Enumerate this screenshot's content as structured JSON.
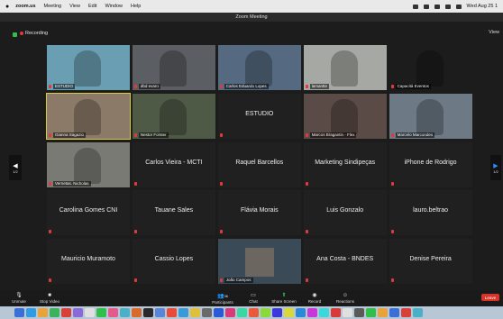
{
  "menubar": {
    "apple": "",
    "app": "zoom.us",
    "items": [
      "Meeting",
      "View",
      "Edit",
      "Window",
      "Help"
    ],
    "clock": "Wed Aug 25 1"
  },
  "window": {
    "title": "Zoom Meeting"
  },
  "status": {
    "recording": "Recording",
    "view": "View"
  },
  "nav": {
    "page_left": "1/2",
    "page_right": "1/2"
  },
  "tiles": [
    {
      "name": "ESTUDIO",
      "kind": "video",
      "color": "#6a9fb3"
    },
    {
      "name": "dbd evaro",
      "kind": "video",
      "color": "#5b5e63"
    },
    {
      "name": "Carlos Eduardo Lopes",
      "kind": "video",
      "color": "#556a80"
    },
    {
      "name": "lamantte",
      "kind": "video",
      "color": "#a6a8a3"
    },
    {
      "name": "Capacità Eventos",
      "kind": "video",
      "color": "#1c1c1c"
    },
    {
      "name": "Gianna Sagazio",
      "kind": "video",
      "color": "#8c7a68"
    },
    {
      "name": "Nestor Forster",
      "kind": "video",
      "color": "#4f5a46"
    },
    {
      "name": "",
      "label": "ESTUDIO",
      "kind": "text"
    },
    {
      "name": "Marcos Bragantin - Flex",
      "kind": "video",
      "color": "#5b4b46"
    },
    {
      "name": "Marcelo Marcondes",
      "kind": "video",
      "color": "#6d7a86"
    },
    {
      "name": "Vernetas. Nicholas",
      "kind": "video",
      "color": "#7a7a74"
    },
    {
      "name": "",
      "label": "Carlos Vieira - MCTI",
      "kind": "text"
    },
    {
      "name": "",
      "label": "Raquel Barcellos",
      "kind": "text"
    },
    {
      "name": "",
      "label": "Marketing Sindipeças",
      "kind": "text"
    },
    {
      "name": "",
      "label": "iPhone de Rodrigo",
      "kind": "text"
    },
    {
      "name": "",
      "label": "Carolina Gomes CNI",
      "kind": "text"
    },
    {
      "name": "",
      "label": "Tauane Sales",
      "kind": "text"
    },
    {
      "name": "",
      "label": "Flávia Morais",
      "kind": "text"
    },
    {
      "name": "",
      "label": "Luis Gonzalo",
      "kind": "text"
    },
    {
      "name": "",
      "label": "lauro.beltrao",
      "kind": "text"
    },
    {
      "name": "",
      "label": "Mauricio Muramoto",
      "kind": "text"
    },
    {
      "name": "",
      "label": "Cassio Lopes",
      "kind": "text"
    },
    {
      "name": "João Campos",
      "kind": "photo",
      "color": "#6b6660"
    },
    {
      "name": "",
      "label": "Ana Costa - BNDES",
      "kind": "text"
    },
    {
      "name": "",
      "label": "Denise Pereira",
      "kind": "text"
    }
  ],
  "toolbar": {
    "unmute": "Unmute",
    "stop_video": "Stop Video",
    "participants": "Participants",
    "participants_count": "36",
    "chat": "Chat",
    "share": "Share Screen",
    "record": "Record",
    "reactions": "Reactions",
    "leave": "Leave"
  },
  "dock_colors": [
    "#3a6fd8",
    "#2f9be0",
    "#e8a33a",
    "#3bb35a",
    "#d8413a",
    "#8a6ad8",
    "#e0e0e0",
    "#2fbf4a",
    "#e55a8a",
    "#4ab0c8",
    "#d86a2a",
    "#2a2a2a",
    "#5a86d8",
    "#e84b3a",
    "#3a9ad8",
    "#e0c03a",
    "#6a6a6a",
    "#2a5ad8",
    "#d83a7a",
    "#3ad8a0",
    "#e85a3a",
    "#8ad83a",
    "#3a3ad8",
    "#d8d83a",
    "#2a8ad8",
    "#c83ad8",
    "#3ad8d8",
    "#d83a3a",
    "#e0e0e0",
    "#5a5a5a",
    "#2fbf4a",
    "#e8a33a",
    "#3a6fd8",
    "#d8413a",
    "#4ab0c8"
  ]
}
